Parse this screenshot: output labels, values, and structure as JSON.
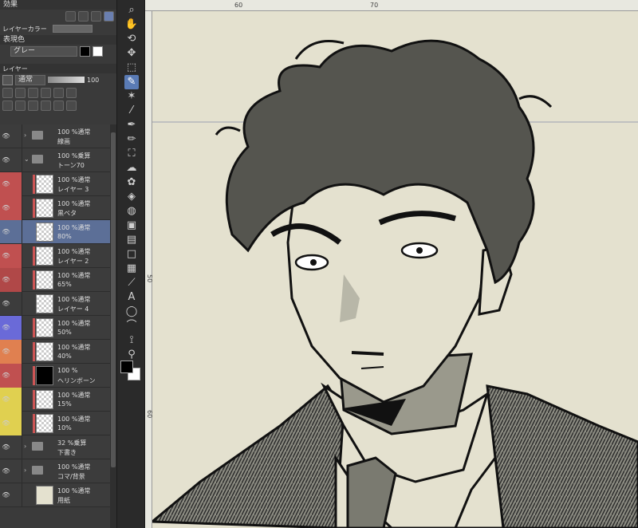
{
  "panel": {
    "effect_title": "効果",
    "layer_color_label": "レイヤーカラー",
    "express_color_title": "表現色",
    "express_color_value": "グレー",
    "layer_tab": "レイヤー",
    "blend_mode": "通常",
    "opacity_value": "100"
  },
  "layers": [
    {
      "top": "100 %通常",
      "bottom": "線画",
      "kind": "folder"
    },
    {
      "top": "100 %乗算",
      "bottom": "トーン70",
      "kind": "folder-open"
    },
    {
      "top": "100 %通常",
      "bottom": "レイヤー 3",
      "kind": "raster",
      "color": "#c05050"
    },
    {
      "top": "100 %通常",
      "bottom": "黒ベタ",
      "kind": "raster",
      "color": "#c05050"
    },
    {
      "top": "100 %通常",
      "bottom": "80%",
      "kind": "raster",
      "active": true
    },
    {
      "top": "100 %通常",
      "bottom": "レイヤー 2",
      "kind": "raster",
      "color": "#c05050"
    },
    {
      "top": "100 %通常",
      "bottom": "65%",
      "kind": "raster",
      "color": "#b04848"
    },
    {
      "top": "100 %通常",
      "bottom": "レイヤー 4",
      "kind": "raster"
    },
    {
      "top": "100 %通常",
      "bottom": "50%",
      "kind": "raster",
      "color": "#6a6ad8"
    },
    {
      "top": "100 %通常",
      "bottom": "40%",
      "kind": "raster",
      "color": "#e08050"
    },
    {
      "top": "100 %",
      "bottom": "ヘリンボーン",
      "kind": "tone",
      "color": "#c05050"
    },
    {
      "top": "100 %通常",
      "bottom": "15%",
      "kind": "raster",
      "color": "#e0d050"
    },
    {
      "top": "100 %通常",
      "bottom": "10%",
      "kind": "raster",
      "color": "#e0d050"
    },
    {
      "top": "32 %乗算",
      "bottom": "下書き",
      "kind": "folder"
    },
    {
      "top": "100 %通常",
      "bottom": "コマ/背景",
      "kind": "folder"
    },
    {
      "top": "100 %通常",
      "bottom": "用紙",
      "kind": "paper"
    }
  ],
  "ruler": {
    "top_60": "60",
    "top_70": "70",
    "left_50": "50",
    "left_60": "60"
  },
  "tools": [
    "search-icon",
    "hand-icon",
    "rotate-icon",
    "move-icon",
    "select-rect-icon",
    "pen-select-icon",
    "magic-wand-icon",
    "eyedropper-icon",
    "pen-icon",
    "pencil-icon",
    "brush-icon",
    "airbrush-icon",
    "deco-icon",
    "eraser-icon",
    "blend-icon",
    "fill-icon",
    "gradient-icon",
    "shape-icon",
    "frame-icon",
    "ruler-icon",
    "text-icon",
    "balloon-icon",
    "line-icon",
    "correct-line-icon",
    "color-picker-icon"
  ],
  "colors": {
    "main": "#000000",
    "sub": "#ffffff",
    "paper": "#e4e1cf",
    "active_layer": "#5c6f97"
  }
}
